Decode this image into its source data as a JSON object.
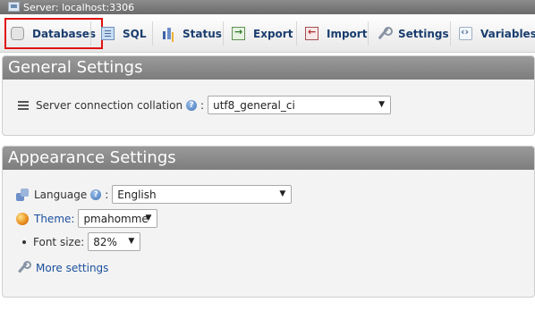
{
  "server_bar": {
    "label": "Server: localhost:3306"
  },
  "tabs": [
    {
      "label": "Databases",
      "active": true
    },
    {
      "label": "SQL"
    },
    {
      "label": "Status"
    },
    {
      "label": "Export"
    },
    {
      "label": "Import"
    },
    {
      "label": "Settings"
    },
    {
      "label": "Variables"
    }
  ],
  "general": {
    "title": "General Settings",
    "collation_label": "Server connection collation",
    "collation_value": "utf8_general_ci"
  },
  "appearance": {
    "title": "Appearance Settings",
    "language_label": "Language",
    "language_value": "English",
    "theme_label": "Theme:",
    "theme_value": "pmahomme",
    "fontsize_label": "Font size:",
    "fontsize_value": "82%",
    "more_settings": "More settings"
  },
  "colors": {
    "highlight": "#e01010",
    "link": "#1a4f9c",
    "header_bg": "#8a8a8a"
  }
}
